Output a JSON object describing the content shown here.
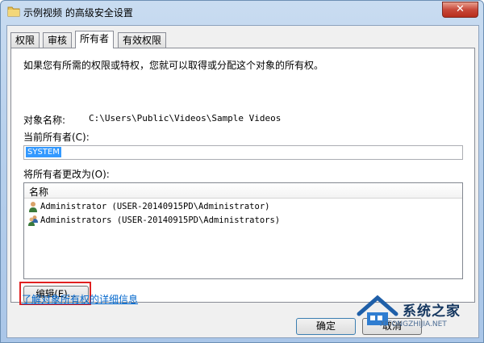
{
  "window": {
    "title": "示例视频 的高级安全设置",
    "close_label": "✕"
  },
  "tabs": [
    {
      "label": "权限",
      "active": false
    },
    {
      "label": "审核",
      "active": false
    },
    {
      "label": "所有者",
      "active": true
    },
    {
      "label": "有效权限",
      "active": false
    }
  ],
  "owner_tab": {
    "description": "如果您有所需的权限或特权，您就可以取得或分配这个对象的所有权。",
    "object_name_label": "对象名称:",
    "object_name_value": "C:\\Users\\Public\\Videos\\Sample Videos",
    "current_owner_label": "当前所有者(C):",
    "current_owner_value": "SYSTEM",
    "change_owner_label": "将所有者更改为(O):",
    "list": {
      "column_header": "名称",
      "items": [
        {
          "name": "Administrator (USER-20140915PD\\Administrator)",
          "icon": "user-icon"
        },
        {
          "name": "Administrators (USER-20140915PD\\Administrators)",
          "icon": "group-icon"
        }
      ]
    },
    "edit_button": "编辑(E)...",
    "learn_more_link": "了解对象所有权的详细信息"
  },
  "buttons": {
    "ok": "确定",
    "cancel": "取消"
  },
  "watermark": {
    "text": "系统之家",
    "url": "XITONGZHIJIA.NET"
  },
  "colors": {
    "highlight_border": "#e02020",
    "selection": "#3399ff",
    "link": "#0066cc"
  }
}
